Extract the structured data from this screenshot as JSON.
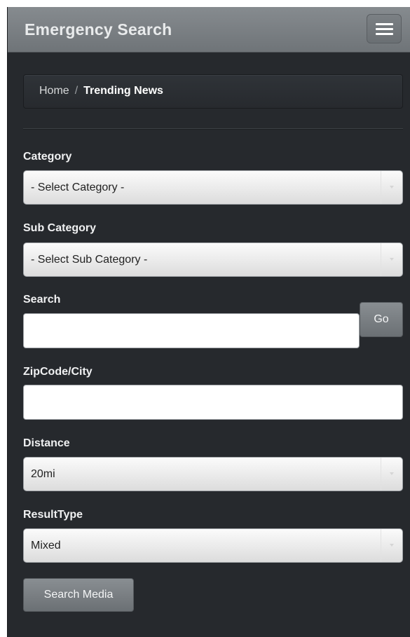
{
  "navbar": {
    "brand": "Emergency Search",
    "menu_icon": "hamburger-menu-icon"
  },
  "breadcrumb": {
    "home": "Home",
    "separator": "/",
    "current": "Trending News"
  },
  "form": {
    "category": {
      "label": "Category",
      "selected": "- Select Category -"
    },
    "sub_category": {
      "label": "Sub Category",
      "selected": "- Select Sub Category -"
    },
    "search": {
      "label": "Search",
      "value": "",
      "go_label": "Go"
    },
    "zipcode": {
      "label": "ZipCode/City",
      "value": ""
    },
    "distance": {
      "label": "Distance",
      "selected": "20mi"
    },
    "result_type": {
      "label": "ResultType",
      "selected": "Mixed"
    },
    "submit_label": "Search Media"
  },
  "colors": {
    "background": "#26292d",
    "navbar": "#7b8084",
    "button": "#7b8084"
  }
}
